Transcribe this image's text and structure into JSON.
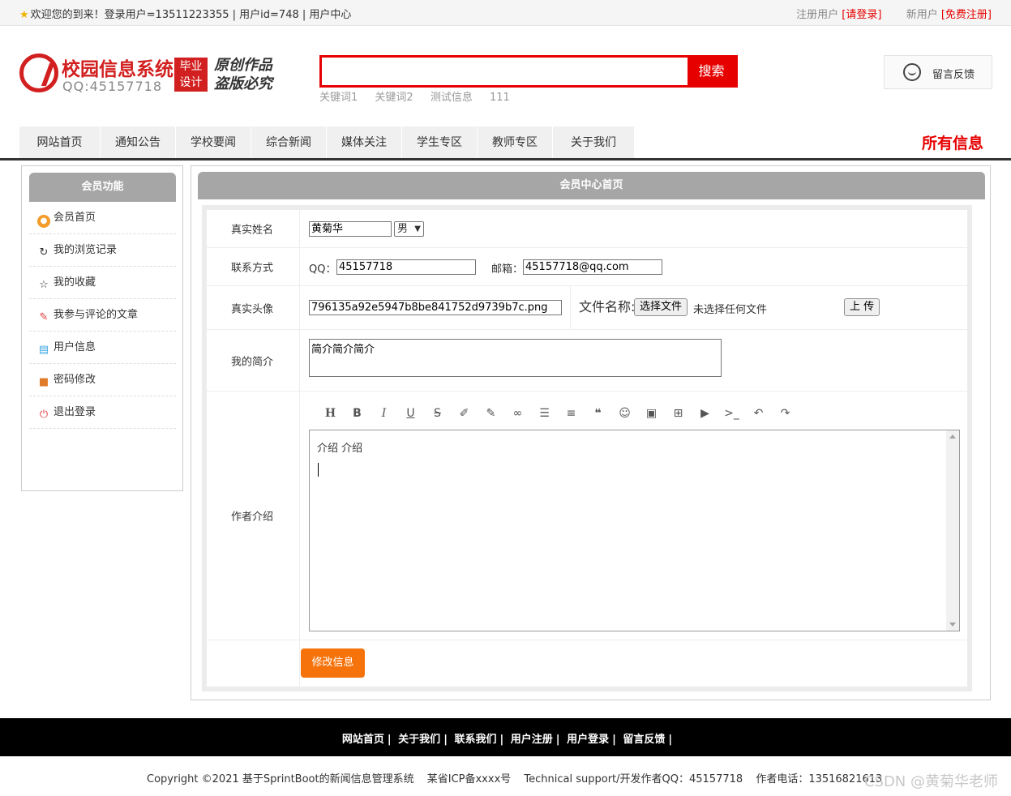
{
  "topbar": {
    "welcome": "欢迎您的到来！登录用户=13511223355 | 用户id=748 | 用户中心",
    "reg_prefix": "注册用户",
    "reg_link": "[请登录]",
    "new_prefix": "新用户",
    "new_link": "[免费注册]"
  },
  "logo": {
    "name": "校园信息系统",
    "qq": "QQ:45157718",
    "tag_line1": "毕业",
    "tag_line2": "设计",
    "motto_line1": "原创作品",
    "motto_line2": "盗版必究"
  },
  "search": {
    "placeholder": "",
    "button": "搜索",
    "keywords": [
      "关键词1",
      "关键词2",
      "测试信息",
      "111"
    ]
  },
  "feedback": {
    "label": "留言反馈"
  },
  "nav": {
    "items": [
      "网站首页",
      "通知公告",
      "学校要闻",
      "综合新闻",
      "媒体关注",
      "学生专区",
      "教师专区",
      "关于我们"
    ],
    "all": "所有信息"
  },
  "sidebar": {
    "title": "会员功能",
    "items": [
      "会员首页",
      "我的浏览记录",
      "我的收藏",
      "我参与评论的文章",
      "用户信息",
      "密码修改",
      "退出登录"
    ]
  },
  "main": {
    "title": "会员中心首页",
    "form": {
      "name_label": "真实姓名",
      "name_value": "黄菊华",
      "gender_value": "男",
      "contact_label": "联系方式",
      "qq_label": "QQ：",
      "qq_value": "45157718",
      "email_label": "邮箱：",
      "email_value": "45157718@qq.com",
      "avatar_label": "真实头像",
      "avatar_value": "796135a92e5947b8be841752d9739b7c.png",
      "file_name_label": "文件名称:",
      "choose_file": "选择文件",
      "no_file": "未选择任何文件",
      "upload": "上 传",
      "intro_label": "我的简介",
      "intro_value": "简介简介简介",
      "author_label": "作者介绍",
      "editor_content": "介绍  介绍",
      "submit": "修改信息"
    }
  },
  "footer": {
    "links": [
      "网站首页",
      "关于我们",
      "联系我们",
      "用户注册",
      "用户登录",
      "留言反馈"
    ]
  },
  "copyright": {
    "text": "Copyright ©2021 基于SprintBoot的新闻信息管理系统",
    "icp": "某省ICP备xxxx号",
    "support": "Technical support/开发作者QQ：45157718",
    "phone": "作者电话：13516821613"
  },
  "watermark": "CSDN @黄菊华老师"
}
